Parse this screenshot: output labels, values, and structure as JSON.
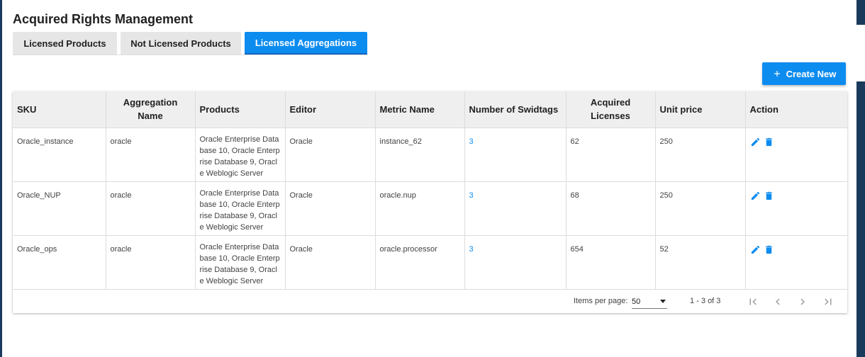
{
  "page": {
    "title": "Acquired Rights Management"
  },
  "tabs": [
    {
      "label": "Licensed Products",
      "active": false
    },
    {
      "label": "Not Licensed Products",
      "active": false
    },
    {
      "label": "Licensed Aggregations",
      "active": true
    }
  ],
  "toolbar": {
    "create_label": "Create New",
    "create_icon": "plus-icon"
  },
  "table": {
    "columns": [
      "SKU",
      "Aggregation Name",
      "Products",
      "Editor",
      "Metric Name",
      "Number of Swidtags",
      "Acquired Licenses",
      "Unit price",
      "Action"
    ],
    "rows": [
      {
        "sku": "Oracle_instance",
        "aggregation": "oracle",
        "products": "Oracle Enterprise Database 10, Oracle Enterprise Database 9, Oracle Weblogic Server",
        "editor": "Oracle",
        "metric": "instance_62",
        "swidtags": "3",
        "licenses": "62",
        "price": "250"
      },
      {
        "sku": "Oracle_NUP",
        "aggregation": "oracle",
        "products": "Oracle Enterprise Database 10, Oracle Enterprise Database 9, Oracle Weblogic Server",
        "editor": "Oracle",
        "metric": "oracle.nup",
        "swidtags": "3",
        "licenses": "68",
        "price": "250"
      },
      {
        "sku": "Oracle_ops",
        "aggregation": "oracle",
        "products": "Oracle Enterprise Database 10, Oracle Enterprise Database 9, Oracle Weblogic Server",
        "editor": "Oracle",
        "metric": "oracle.processor",
        "swidtags": "3",
        "licenses": "654",
        "price": "52"
      }
    ],
    "action_icons": [
      "edit-icon",
      "delete-icon"
    ]
  },
  "paginator": {
    "items_per_page_label": "Items per page:",
    "page_size": "50",
    "range_label": "1 - 3 of 3"
  },
  "colors": {
    "accent": "#0d8cf0",
    "header_bg": "#efefef",
    "frame": "#1a3a5c"
  }
}
